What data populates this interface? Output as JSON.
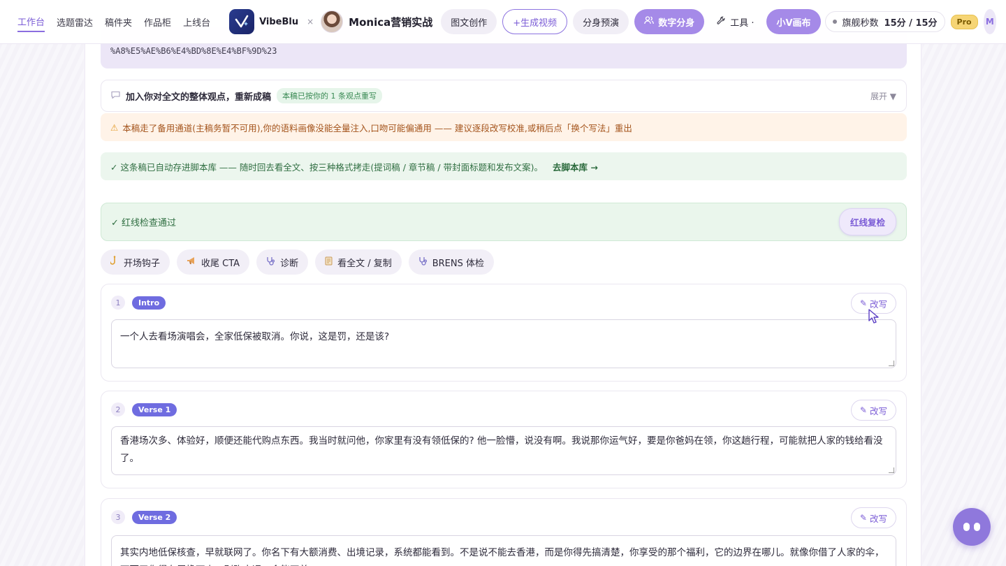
{
  "nav": {
    "links": [
      "工作台",
      "选题雷达",
      "稿件夹",
      "作品柜",
      "上线台"
    ],
    "brand": "VibeBlu",
    "separator": "×",
    "partner": "Monica营销实战",
    "buttons": {
      "graphic": "图文创作",
      "gen_video": "+生成视频",
      "rehearsal": "分身预演",
      "digital_twin": "数字分身",
      "tools": "工具 ·",
      "canvas": "小V画布"
    },
    "quota": {
      "label": "旗舰秒数",
      "value": "15分 / 15分"
    },
    "plan_badge": "Pro",
    "user_initial": "M"
  },
  "page": {
    "url_text": "%A8%E5%AE%B6%E4%BD%8E%E4%BF%9D%23",
    "opinion": {
      "title": "加入你对全文的整体观点，重新成稿",
      "badge": "本稿已按你的 1 条观点重写",
      "expand": "展开 ▼"
    },
    "warning": "本稿走了备用通道(主稿务暂不可用),你的语料画像没能全量注入,口吻可能偏通用 —— 建议逐段改写校准,或稍后点「换个写法」重出",
    "saved": {
      "text": "✓ 这条稿已自动存进脚本库 —— 随时回去看全文、按三种格式拷走(提词稿 / 章节稿 / 带封面标题和发布文案)。",
      "link": "去脚本库 →"
    },
    "redline": {
      "text": "✓ 红线检查通过",
      "button": "红线复检"
    },
    "chips": [
      "开场钩子",
      "收尾 CTA",
      "诊断",
      "看全文 / 复制",
      "BRENS 体检"
    ],
    "rewrite_label": "改写",
    "sections": [
      {
        "num": "1",
        "tag": "Intro",
        "text": "一个人去看场演唱会，全家低保被取消。你说，这是罚，还是该?"
      },
      {
        "num": "2",
        "tag": "Verse 1",
        "text": "香港场次多、体验好，顺便还能代购点东西。我当时就问他，你家里有没有领低保的? 他一脸懵，说没有啊。我说那你运气好，要是你爸妈在领，你这趟行程，可能就把人家的钱给看没了。"
      },
      {
        "num": "3",
        "tag": "Verse 2",
        "text": "其实内地低保核查，早就联网了。你名下有大额消费、出境记录，系统都能看到。不是说不能去香港，而是你得先搞清楚，你享受的那个福利，它的边界在哪儿。就像你借了人家的伞，下雨天你得在屋檐下走，别跑太远，伞能不着"
      }
    ]
  },
  "colors": {
    "accent": "#8b6ee0",
    "success": "#2f6e41",
    "warning": "#a4541c"
  }
}
